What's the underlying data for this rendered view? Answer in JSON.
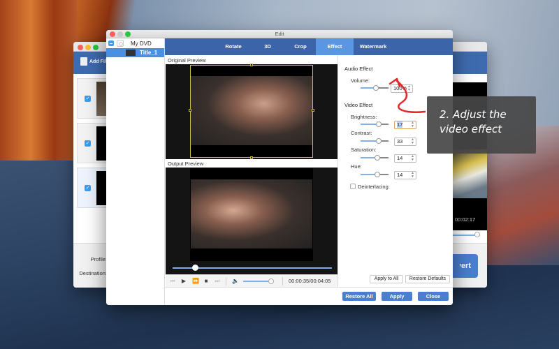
{
  "back_window": {
    "toolbar": {
      "add_file_label": "Add File"
    },
    "files": [
      {
        "checked": true
      },
      {
        "checked": true
      },
      {
        "checked": true
      }
    ],
    "bottom": {
      "profile_label": "Profile:",
      "destination_label": "Destination:"
    },
    "preview_time": "00:02:17",
    "convert_label": "Convert"
  },
  "edit_window": {
    "title": "Edit",
    "tree": {
      "root_label": "My DVD",
      "child_label": "Title_1"
    },
    "tabs": [
      {
        "label": "Rotate",
        "active": false
      },
      {
        "label": "3D",
        "active": false
      },
      {
        "label": "Crop",
        "active": false
      },
      {
        "label": "Effect",
        "active": true
      },
      {
        "label": "Watermark",
        "active": false
      }
    ],
    "original_preview_label": "Original Preview",
    "output_preview_label": "Output Preview",
    "player": {
      "current_time": "00:00:35",
      "total_time": "00:04:05",
      "time_display": "00:00:35/00:04:05",
      "seek_progress": 0.14,
      "volume_level": 1.0
    },
    "effect": {
      "audio_heading": "Audio Effect",
      "volume_label": "Volume:",
      "volume_value": "100%",
      "video_heading": "Video Effect",
      "controls": [
        {
          "label": "Brightness:",
          "value": "17",
          "focused": true
        },
        {
          "label": "Contrast:",
          "value": "33",
          "focused": false
        },
        {
          "label": "Saturation:",
          "value": "14",
          "focused": false
        },
        {
          "label": "Hue:",
          "value": "14",
          "focused": false
        }
      ],
      "deinterlacing_label": "Deinterlacing",
      "deinterlacing_checked": false,
      "apply_to_all_label": "Apply to All",
      "restore_defaults_label": "Restore Defaults"
    },
    "footer": {
      "restore_all_label": "Restore All",
      "apply_label": "Apply",
      "close_label": "Close"
    }
  },
  "annotation": {
    "line1": "2. Adjust the",
    "line2": "video effect",
    "arrow_color": "#e0282a"
  },
  "colors": {
    "accent": "#3c65a9",
    "active_tab": "#5a96e3",
    "button_blue": "#4a7fd0",
    "slider_blue": "#7fb0e8"
  }
}
